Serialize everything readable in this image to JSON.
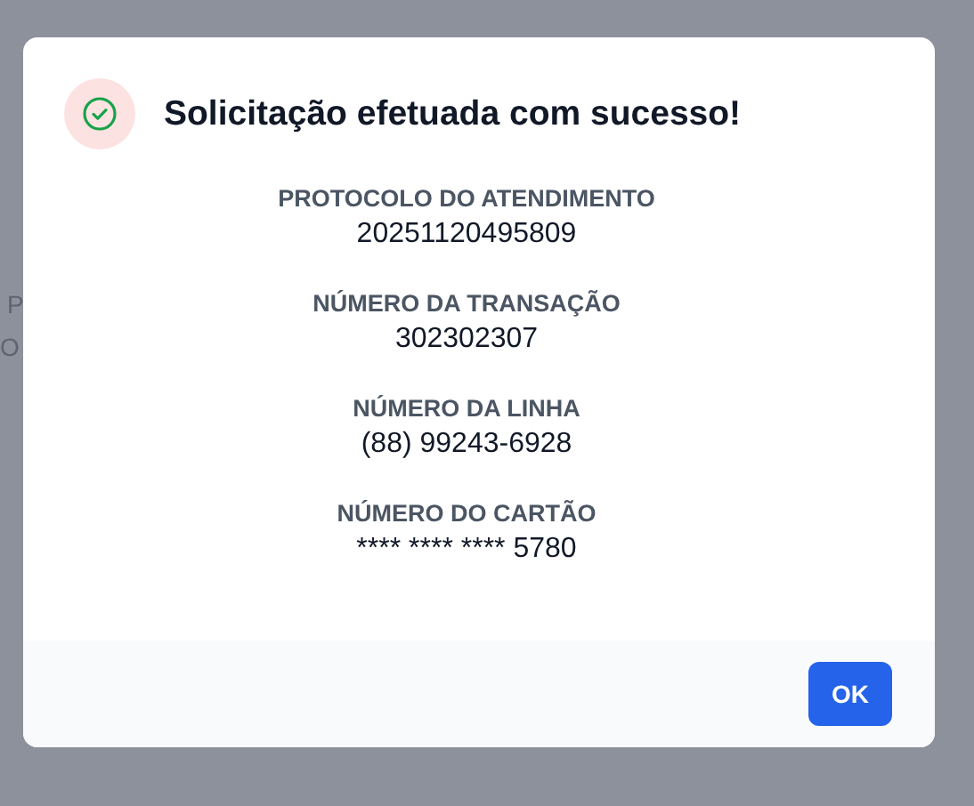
{
  "background_texts": [
    "P",
    "O"
  ],
  "dialog": {
    "title": "Solicitação efetuada com sucesso!",
    "fields": [
      {
        "label": "PROTOCOLO DO ATENDIMENTO",
        "value": "20251120495809"
      },
      {
        "label": "NÚMERO DA TRANSAÇÃO",
        "value": "302302307"
      },
      {
        "label": "NÚMERO DA LINHA",
        "value": "(88) 99243-6928"
      },
      {
        "label": "NÚMERO DO CARTÃO",
        "value": "**** **** **** 5780"
      }
    ],
    "buttons": [
      "OK"
    ]
  }
}
